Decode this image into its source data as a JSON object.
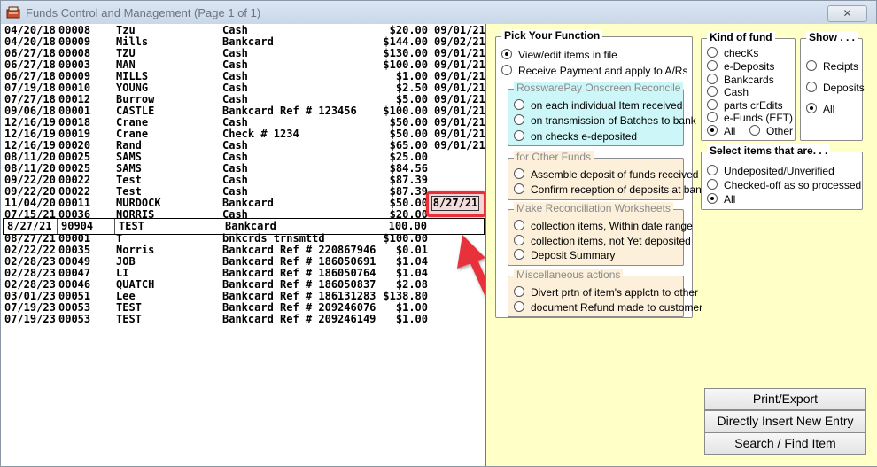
{
  "window": {
    "title": "Funds Control and Management (Page 1 of 1)",
    "close_label": "✕"
  },
  "records": [
    {
      "date": "04/20/18",
      "num": "00008",
      "name": "Tzu",
      "type": "Cash",
      "amount": "$20.00",
      "date2": "09/01/21"
    },
    {
      "date": "04/20/18",
      "num": "00009",
      "name": "Mills",
      "type": "Bankcard",
      "amount": "$144.00",
      "date2": "09/02/21"
    },
    {
      "date": "06/27/18",
      "num": "00008",
      "name": "TZU",
      "type": "Cash",
      "amount": "$130.00",
      "date2": "09/01/21"
    },
    {
      "date": "06/27/18",
      "num": "00003",
      "name": "MAN",
      "type": "Cash",
      "amount": "$100.00",
      "date2": "09/01/21"
    },
    {
      "date": "06/27/18",
      "num": "00009",
      "name": "MILLS",
      "type": "Cash",
      "amount": "$1.00",
      "date2": "09/01/21"
    },
    {
      "date": "07/19/18",
      "num": "00010",
      "name": "YOUNG",
      "type": "Cash",
      "amount": "$2.50",
      "date2": "09/01/21"
    },
    {
      "date": "07/27/18",
      "num": "00012",
      "name": "Burrow",
      "type": "Cash",
      "amount": "$5.00",
      "date2": "09/01/21"
    },
    {
      "date": "09/06/18",
      "num": "00001",
      "name": "CASTLE",
      "type": "Bankcard Ref # 123456",
      "amount": "$100.00",
      "date2": "09/01/21"
    },
    {
      "date": "12/16/19",
      "num": "00018",
      "name": "Crane",
      "type": "Cash",
      "amount": "$50.00",
      "date2": "09/01/21"
    },
    {
      "date": "12/16/19",
      "num": "00019",
      "name": "Crane",
      "type": "Check # 1234",
      "amount": "$50.00",
      "date2": "09/01/21"
    },
    {
      "date": "12/16/19",
      "num": "00020",
      "name": "Rand",
      "type": "Cash",
      "amount": "$65.00",
      "date2": "09/01/21"
    },
    {
      "date": "08/11/20",
      "num": "00025",
      "name": "SAMS",
      "type": "Cash",
      "amount": "$25.00",
      "date2": ""
    },
    {
      "date": "08/11/20",
      "num": "00025",
      "name": "SAMS",
      "type": "Cash",
      "amount": "$84.56",
      "date2": ""
    },
    {
      "date": "09/22/20",
      "num": "00022",
      "name": "Test",
      "type": "Cash",
      "amount": "$87.39",
      "date2": ""
    },
    {
      "date": "09/22/20",
      "num": "00022",
      "name": "Test",
      "type": "Cash",
      "amount": "$87.39",
      "date2": ""
    },
    {
      "date": "11/04/20",
      "num": "00011",
      "name": "MURDOCK",
      "type": "Bankcard",
      "amount": "$50.00",
      "date2": ""
    },
    {
      "date": "07/15/21",
      "num": "00036",
      "name": "NORRIS",
      "type": "Cash",
      "amount": "$20.00",
      "date2": ""
    }
  ],
  "selected_record": {
    "date": "8/27/21",
    "num": "90904",
    "name": "TEST",
    "type": "Bankcard",
    "amount": "100.00",
    "date2": "8/27/21"
  },
  "records_after": [
    {
      "date": "08/27/21",
      "num": "00001",
      "name": "T",
      "type": "bnkcrds trnsmttd",
      "amount": "$100.00",
      "date2": ""
    },
    {
      "date": "02/22/22",
      "num": "00035",
      "name": "Norris",
      "type": "Bankcard Ref # 220867946",
      "amount": "$0.01",
      "date2": ""
    },
    {
      "date": "02/28/23",
      "num": "00049",
      "name": "JOB",
      "type": "Bankcard Ref # 186050691",
      "amount": "$1.04",
      "date2": ""
    },
    {
      "date": "02/28/23",
      "num": "00047",
      "name": "LI",
      "type": "Bankcard Ref # 186050764",
      "amount": "$1.04",
      "date2": ""
    },
    {
      "date": "02/28/23",
      "num": "00046",
      "name": "QUATCH",
      "type": "Bankcard Ref # 186050837",
      "amount": "$2.08",
      "date2": ""
    },
    {
      "date": "03/01/23",
      "num": "00051",
      "name": "Lee",
      "type": "Bankcard Ref # 186131283",
      "amount": "$138.80",
      "date2": ""
    },
    {
      "date": "07/19/23",
      "num": "00053",
      "name": "TEST",
      "type": "Bankcard Ref # 209246076",
      "amount": "$1.00",
      "date2": ""
    },
    {
      "date": "07/19/23",
      "num": "00053",
      "name": "TEST",
      "type": "Bankcard Ref # 209246149",
      "amount": "$1.00",
      "date2": ""
    }
  ],
  "pick_function": {
    "label": "Pick Your Function",
    "view_edit": "View/edit items in file",
    "receive_payment": "Receive Payment and apply to A/Rs",
    "rpay_group": "RosswarePay Onscreen Reconcile",
    "rpay_items": [
      "on each individual Item received",
      "on transmission of Batches to bank",
      "on checks e-deposited"
    ],
    "other_group": "for Other Funds",
    "other_items": [
      "Assemble deposit of funds received",
      "Confirm reception of deposits at bank"
    ],
    "recon_group": "Make Reconciliation Worksheets",
    "recon_items": [
      "collection items, Within date range",
      "collection items, not Yet deposited",
      "Deposit Summary"
    ],
    "misc_group": "Miscellaneous actions",
    "misc_items": [
      "Divert prtn of item's applctn to other",
      "document Refund made to customer"
    ]
  },
  "kind_of_fund": {
    "label": "Kind of fund",
    "items": [
      "checKs",
      "e-Deposits",
      "Bankcards",
      "Cash",
      "parts crEdits",
      "e-Funds (EFT)"
    ],
    "all": "All",
    "other": "Other"
  },
  "show": {
    "label": "Show . . .",
    "items": [
      "Recipts",
      "Deposits",
      "All"
    ]
  },
  "select_items": {
    "label": "Select items that are. . .",
    "items": [
      "Undeposited/Unverified",
      "Checked-off as so processed",
      "All"
    ]
  },
  "buttons": {
    "print_export": "Print/Export",
    "insert_entry": "Directly Insert New Entry",
    "search": "Search / Find Item"
  }
}
